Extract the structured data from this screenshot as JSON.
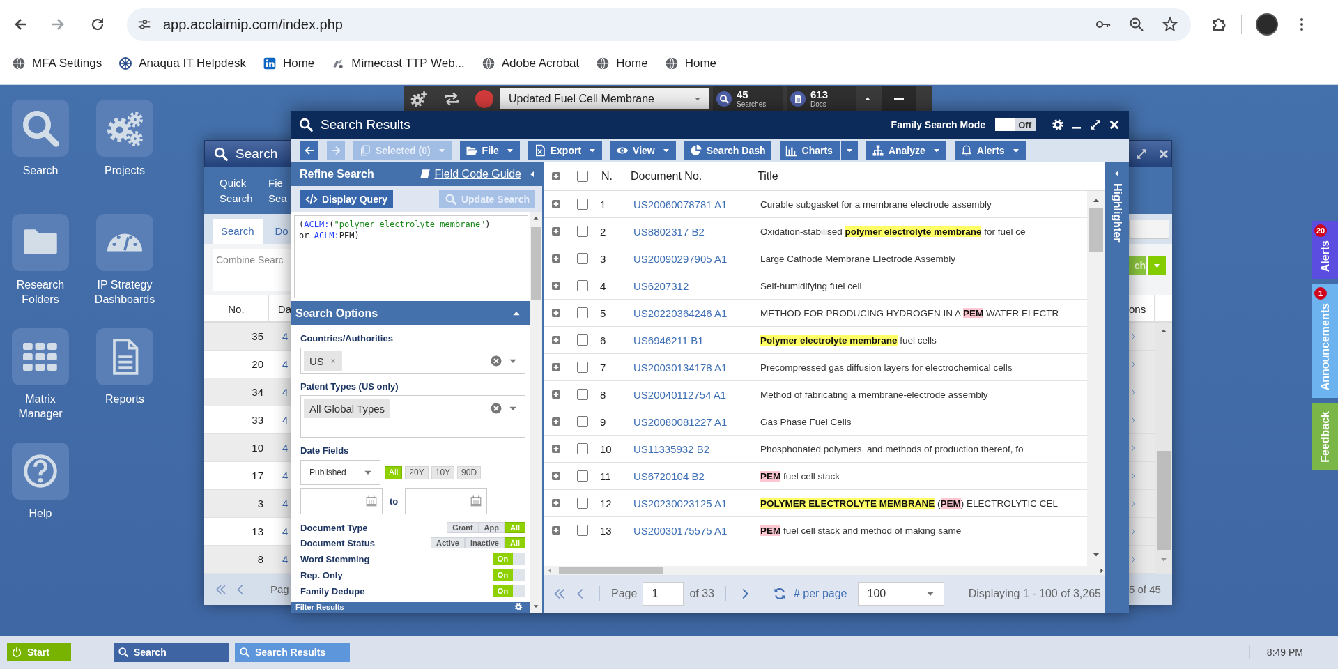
{
  "browser": {
    "url": "app.acclaimip.com/index.php",
    "bookmarks": [
      {
        "kind": "globe",
        "label": "MFA Settings"
      },
      {
        "kind": "wheel",
        "label": "Anaqua IT Helpdesk"
      },
      {
        "kind": "square",
        "label": "Home"
      },
      {
        "kind": "swirl",
        "label": "Mimecast TTP Web..."
      },
      {
        "kind": "globe",
        "label": "Adobe Acrobat"
      },
      {
        "kind": "globe",
        "label": "Home"
      },
      {
        "kind": "globe",
        "label": "Home"
      }
    ]
  },
  "desktop_icons": [
    {
      "kind": "search",
      "label": "Search"
    },
    {
      "kind": "gears",
      "label": "Projects"
    },
    {
      "kind": "folder",
      "label": "Research Folders"
    },
    {
      "kind": "gauge",
      "label": "IP Strategy Dashboards"
    },
    {
      "kind": "grid",
      "label": "Matrix Manager"
    },
    {
      "kind": "report",
      "label": "Reports"
    },
    {
      "kind": "help",
      "label": "Help"
    }
  ],
  "quick_toolbar": {
    "saved_search": "Updated Fuel Cell Membrane",
    "counters": [
      {
        "kind": "searches",
        "value": "45",
        "label": "Searches"
      },
      {
        "kind": "docs",
        "value": "613",
        "label": "Docs"
      }
    ]
  },
  "search_window": {
    "title": "Search",
    "tabs": [
      "Quick Search",
      "Fie Sea"
    ],
    "subtabs": [
      {
        "label": "Search",
        "selected": true
      },
      {
        "label": "Do",
        "selected": false
      }
    ],
    "combine_placeholder": "Combine Searc",
    "search_button": "ch",
    "columns": [
      "No.",
      "Da",
      "ons"
    ],
    "rows": [
      {
        "no": "35",
        "column_2": "4"
      },
      {
        "no": "20",
        "column_2": "4"
      },
      {
        "no": "34",
        "column_2": "4"
      },
      {
        "no": "33",
        "column_2": "4"
      },
      {
        "no": "10",
        "column_2": "4"
      },
      {
        "no": "17",
        "column_2": "4"
      },
      {
        "no": "3",
        "column_2": "4"
      },
      {
        "no": "13",
        "column_2": "4"
      },
      {
        "no": "8",
        "column_2": "4"
      }
    ],
    "pager": {
      "page_label": "Pag",
      "count": "5 of 45"
    }
  },
  "results_window": {
    "title": "Search Results",
    "family_mode": {
      "label": "Family Search Mode",
      "state": "Off",
      "on": false
    },
    "toolbar": [
      {
        "kind": "back",
        "disabled": false,
        "caret": false,
        "split": false
      },
      {
        "kind": "forward",
        "disabled": true,
        "caret": false,
        "split": false
      },
      {
        "kind": "copy",
        "label": "Selected (0)",
        "disabled": true,
        "caret": true,
        "split": false
      },
      {
        "kind": "folder",
        "label": "File",
        "disabled": false,
        "caret": true,
        "split": false
      },
      {
        "kind": "excel",
        "label": "Export",
        "disabled": false,
        "caret": true,
        "split": false
      },
      {
        "kind": "eye",
        "label": "View",
        "disabled": false,
        "caret": true,
        "split": false
      },
      {
        "kind": "pie",
        "label": "Search Dash",
        "disabled": false,
        "caret": false,
        "split": false
      },
      {
        "kind": "bars",
        "label": "Charts",
        "disabled": false,
        "caret": false,
        "split": true
      },
      {
        "kind": "tree",
        "label": "Analyze",
        "disabled": false,
        "caret": true,
        "split": false
      },
      {
        "kind": "bell",
        "label": "Alerts",
        "disabled": false,
        "caret": true,
        "split": false
      }
    ],
    "refine": {
      "title": "Refine Search",
      "guide_link": "Field Code Guide",
      "display_query": "Display Query",
      "update_search": {
        "label": "Update Search",
        "disabled": true
      },
      "query": [
        {
          "kind": "plain",
          "text": "("
        },
        {
          "kind": "field",
          "text": "ACLM:"
        },
        {
          "kind": "plain",
          "text": "("
        },
        {
          "kind": "string",
          "text": "\"polymer electrolyte membrane\""
        },
        {
          "kind": "plain",
          "text": ")\nor "
        },
        {
          "kind": "field",
          "text": "ACLM:"
        },
        {
          "kind": "plain",
          "text": "PEM)"
        }
      ],
      "options_title": "Search Options",
      "countries": {
        "label": "Countries/Authorities",
        "tags": [
          "US"
        ]
      },
      "patent_types": {
        "label": "Patent Types (US only)",
        "tags": [
          "All Global Types"
        ]
      },
      "date": {
        "label": "Date Fields",
        "field": "Published",
        "to": "to",
        "ranges": [
          {
            "label": "All",
            "selected": true
          },
          {
            "label": "20Y",
            "selected": false
          },
          {
            "label": "10Y",
            "selected": false
          },
          {
            "label": "90D",
            "selected": false
          }
        ]
      },
      "segments": [
        {
          "label": "Document Type",
          "options": [
            {
              "label": "Grant",
              "selected": false
            },
            {
              "label": "App",
              "selected": false
            },
            {
              "label": "All",
              "selected": true
            }
          ]
        },
        {
          "label": "Document Status",
          "options": [
            {
              "label": "Active",
              "selected": false
            },
            {
              "label": "Inactive",
              "selected": false
            },
            {
              "label": "All",
              "selected": true
            }
          ]
        }
      ],
      "switches": [
        {
          "label": "Word Stemming",
          "state": "On",
          "on": true
        },
        {
          "label": "Rep. Only",
          "state": "On",
          "on": true
        },
        {
          "label": "Family Dedupe",
          "state": "On",
          "on": true
        }
      ],
      "filter_title": "Filter Results"
    },
    "table": {
      "select_all": {
        "checked": false
      },
      "columns": [
        "N.",
        "Document No.",
        "Title"
      ],
      "rows": [
        {
          "n": "1",
          "doc": "US20060078781 A1",
          "checked": false,
          "title": [
            {
              "kind": "plain",
              "text": "Curable subgasket for a membrane electrode assembly"
            }
          ]
        },
        {
          "n": "2",
          "doc": "US8802317 B2",
          "checked": false,
          "title": [
            {
              "kind": "plain",
              "text": "Oxidation-stabilised "
            },
            {
              "kind": "phrase",
              "text": "polymer electrolyte membrane"
            },
            {
              "kind": "plain",
              "text": " for fuel ce"
            }
          ]
        },
        {
          "n": "3",
          "doc": "US20090297905 A1",
          "checked": false,
          "title": [
            {
              "kind": "plain",
              "text": "Large Cathode Membrane Electrode Assembly"
            }
          ]
        },
        {
          "n": "4",
          "doc": "US6207312",
          "checked": false,
          "title": [
            {
              "kind": "plain",
              "text": "Self-humidifying fuel cell"
            }
          ]
        },
        {
          "n": "5",
          "doc": "US20220364246 A1",
          "checked": false,
          "title": [
            {
              "kind": "plain",
              "text": "METHOD FOR PRODUCING HYDROGEN IN A "
            },
            {
              "kind": "term",
              "text": "PEM"
            },
            {
              "kind": "plain",
              "text": " WATER ELECTR"
            }
          ]
        },
        {
          "n": "6",
          "doc": "US6946211 B1",
          "checked": false,
          "title": [
            {
              "kind": "phrase",
              "text": "Polymer electrolyte membrane"
            },
            {
              "kind": "plain",
              "text": " fuel cells"
            }
          ]
        },
        {
          "n": "7",
          "doc": "US20030134178 A1",
          "checked": false,
          "title": [
            {
              "kind": "plain",
              "text": "Precompressed gas diffusion layers for electrochemical cells"
            }
          ]
        },
        {
          "n": "8",
          "doc": "US20040112754 A1",
          "checked": false,
          "title": [
            {
              "kind": "plain",
              "text": "Method of fabricating a membrane-electrode assembly"
            }
          ]
        },
        {
          "n": "9",
          "doc": "US20080081227 A1",
          "checked": false,
          "title": [
            {
              "kind": "plain",
              "text": "Gas Phase Fuel Cells"
            }
          ]
        },
        {
          "n": "10",
          "doc": "US11335932 B2",
          "checked": false,
          "title": [
            {
              "kind": "plain",
              "text": "Phosphonated polymers, and methods of production thereof, fo"
            }
          ]
        },
        {
          "n": "11",
          "doc": "US6720104 B2",
          "checked": false,
          "title": [
            {
              "kind": "term",
              "text": "PEM"
            },
            {
              "kind": "plain",
              "text": " fuel cell stack"
            }
          ]
        },
        {
          "n": "12",
          "doc": "US20230023125 A1",
          "checked": false,
          "title": [
            {
              "kind": "phrase",
              "text": "POLYMER ELECTROLYTE MEMBRANE"
            },
            {
              "kind": "plain",
              "text": " ("
            },
            {
              "kind": "term",
              "text": "PEM"
            },
            {
              "kind": "plain",
              "text": ") ELECTROLYTIC CEL"
            }
          ]
        },
        {
          "n": "13",
          "doc": "US20030175575 A1",
          "checked": false,
          "title": [
            {
              "kind": "term",
              "text": "PEM"
            },
            {
              "kind": "plain",
              "text": " fuel cell stack and method of making same"
            }
          ]
        }
      ],
      "pager": {
        "page_label": "Page",
        "page": "1",
        "of": "of 33",
        "per_page_label": "# per page",
        "per_page": "100",
        "summary": "Displaying 1 - 100 of 3,265"
      }
    },
    "highlighter": "Highlighter"
  },
  "side_tabs": [
    {
      "label": "Alerts",
      "badge": "20",
      "color": "#5a4de0"
    },
    {
      "label": "Announcements",
      "badge": "1",
      "color": "#6db3ef"
    },
    {
      "label": "Feedback",
      "color": "#7ab648"
    }
  ],
  "taskbar": {
    "start": "Start",
    "tasks": [
      {
        "label": "Search",
        "selected": false
      },
      {
        "label": "Search Results",
        "selected": true
      }
    ],
    "clock": "8:49 PM"
  }
}
